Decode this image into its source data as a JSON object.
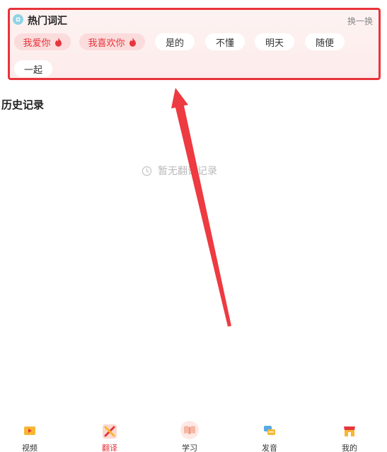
{
  "hot_words": {
    "title": "热门词汇",
    "refresh_label": "换一换",
    "chips": [
      {
        "label": "我爱你",
        "hot": true
      },
      {
        "label": "我喜欢你",
        "hot": true
      },
      {
        "label": "是的",
        "hot": false
      },
      {
        "label": "不懂",
        "hot": false
      },
      {
        "label": "明天",
        "hot": false
      },
      {
        "label": "随便",
        "hot": false
      },
      {
        "label": "一起",
        "hot": false
      }
    ]
  },
  "history": {
    "title": "历史记录",
    "empty_text": "暂无翻译记录"
  },
  "tabbar": {
    "active": "翻译",
    "items": [
      {
        "label": "视频",
        "icon": "video-icon"
      },
      {
        "label": "翻译",
        "icon": "translate-icon"
      },
      {
        "label": "学习",
        "icon": "book-icon"
      },
      {
        "label": "发音",
        "icon": "chat-bubbles-icon"
      },
      {
        "label": "我的",
        "icon": "shop-icon"
      }
    ]
  },
  "colors": {
    "accent": "#e8343b",
    "chip_hot_bg": "#fbdcdc",
    "card_bg": "#fdf0ef"
  }
}
